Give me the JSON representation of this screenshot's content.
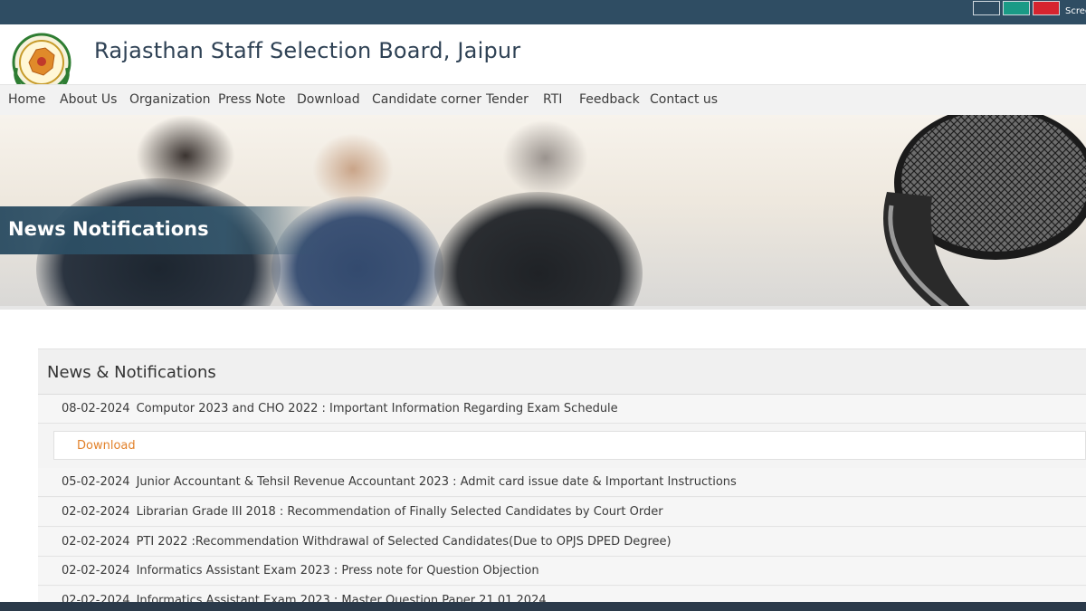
{
  "topbar": {
    "screen_label": "Scree",
    "swatches": [
      "#2f4d63",
      "#1a9a86",
      "#d6242f"
    ]
  },
  "header": {
    "site_title": "Rajasthan Staff Selection Board, Jaipur"
  },
  "nav": {
    "items": [
      "Home",
      "About Us",
      "Organization",
      "Press Note",
      "Download",
      "Candidate corner",
      "Tender",
      "RTI",
      "Feedback",
      "Contact us"
    ]
  },
  "banner": {
    "title": "News Notifications"
  },
  "news": {
    "heading": "News & Notifications",
    "items": [
      {
        "date": "08-02-2024",
        "text": "Computor 2023 and CHO 2022 : Important Information Regarding Exam Schedule"
      },
      {
        "date": "05-02-2024",
        "text": "Junior Accountant & Tehsil Revenue Accountant 2023 : Admit card issue date & Important Instructions"
      },
      {
        "date": "02-02-2024",
        "text": "Librarian Grade III 2018 : Recommendation of Finally Selected Candidates by Court Order"
      },
      {
        "date": "02-02-2024",
        "text": "PTI 2022 :Recommendation Withdrawal of Selected Candidates(Due to OPJS DPED Degree)"
      },
      {
        "date": "02-02-2024",
        "text": "Informatics Assistant Exam 2023 : Press note for Question Objection"
      },
      {
        "date": "02-02-2024",
        "text": "Informatics Assistant Exam 2023 : Master Question Paper  21.01.2024"
      }
    ],
    "download_label": "Download"
  },
  "colors": {
    "topbar": "#2f4d63",
    "nav_bg": "#f2f2f2",
    "download_link": "#e2822b",
    "banner_strip": "#284a60"
  }
}
